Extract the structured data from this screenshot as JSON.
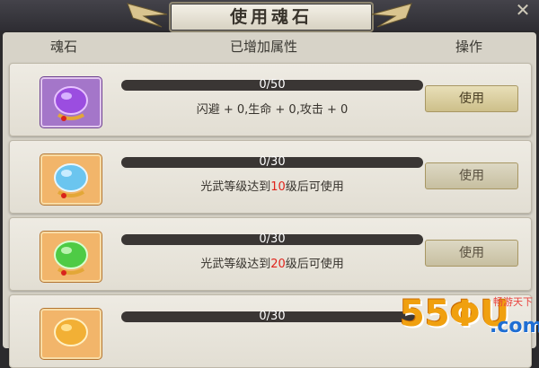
{
  "header": {
    "title": "使用魂石",
    "close_icon": "close-icon"
  },
  "columns": {
    "soulstone": "魂石",
    "added_attr": "已增加属性",
    "action": "操作"
  },
  "colors": {
    "accent": "#c9a15a",
    "highlight_number": "#e0241c"
  },
  "rows": [
    {
      "gem_color": "#9b4de0",
      "frame": "purple",
      "progress_text": "0/50",
      "progress": 0.0,
      "desc_pre": "闪避 + 0,生命 + 0,攻击 + 0",
      "desc_num": "",
      "desc_post": "",
      "button": "使用",
      "enabled": true
    },
    {
      "gem_color": "#6bc5ef",
      "frame": "orange",
      "progress_text": "0/30",
      "progress": 0.0,
      "desc_pre": "光武等级达到",
      "desc_num": "10",
      "desc_post": "级后可使用",
      "button": "使用",
      "enabled": false
    },
    {
      "gem_color": "#4ecb45",
      "frame": "orange",
      "progress_text": "0/30",
      "progress": 0.0,
      "desc_pre": "光武等级达到",
      "desc_num": "20",
      "desc_post": "级后可使用",
      "button": "使用",
      "enabled": false
    },
    {
      "gem_color": "#f2b035",
      "frame": "orange",
      "progress_text": "0/30",
      "progress": 0.0,
      "desc_pre": "",
      "desc_num": "",
      "desc_post": "",
      "button": "",
      "enabled": false
    }
  ],
  "watermark": {
    "number": "55ΦU",
    "domain": ".com",
    "site": "畅游天下"
  }
}
